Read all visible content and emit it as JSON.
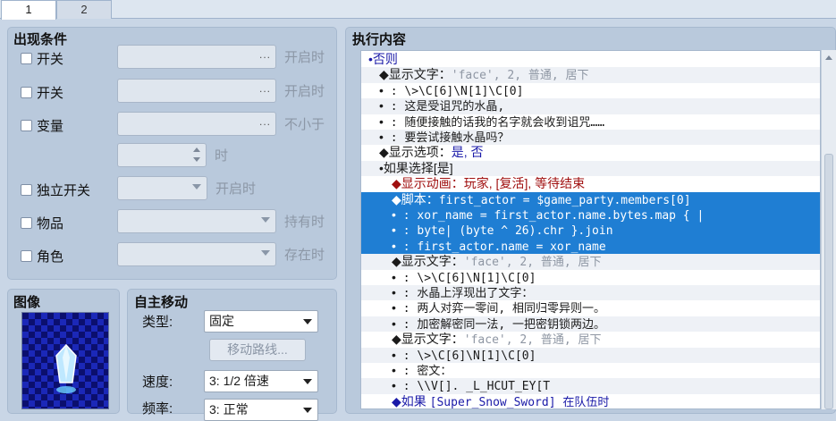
{
  "tabs": [
    {
      "label": "1",
      "active": true
    },
    {
      "label": "2",
      "active": false
    }
  ],
  "conditions": {
    "title": "出现条件",
    "rows": [
      {
        "label": "开关",
        "suffix": "开启时",
        "control": "dots"
      },
      {
        "label": "开关",
        "suffix": "开启时",
        "control": "dots"
      },
      {
        "label": "变量",
        "suffix": "不小于",
        "control": "dots"
      },
      {
        "label": "",
        "suffix": "时",
        "control": "spin"
      },
      {
        "label": "独立开关",
        "suffix": "开启时",
        "control": "dropdown"
      },
      {
        "label": "物品",
        "suffix": "持有时",
        "control": "dropdown"
      },
      {
        "label": "角色",
        "suffix": "存在时",
        "control": "dropdown"
      }
    ],
    "dots_glyph": "..."
  },
  "image": {
    "title": "图像"
  },
  "move": {
    "title": "自主移动",
    "type_label": "类型:",
    "type_value": "固定",
    "route_button": "移动路线...",
    "speed_label": "速度:",
    "speed_value": "3: 1/2 倍速",
    "freq_label": "频率:",
    "freq_value": "3: 正常"
  },
  "commands": {
    "title": "执行内容",
    "rows": [
      {
        "indent": 8,
        "segments": [
          {
            "t": "•否则",
            "c": "c-blue"
          }
        ]
      },
      {
        "indent": 20,
        "segments": [
          {
            "t": "◆显示文字：",
            "c": ""
          },
          {
            "t": "'face', 2, 普通, 居下",
            "c": "c-gray mono"
          }
        ]
      },
      {
        "indent": 20,
        "segments": [
          {
            "t": "•",
            "c": ""
          },
          {
            "t": "           : \\>\\C[6]\\N[1]\\C[0]",
            "c": "mono"
          }
        ]
      },
      {
        "indent": 20,
        "segments": [
          {
            "t": "•",
            "c": ""
          },
          {
            "t": "           : 这是受诅咒的水晶,",
            "c": "mono"
          }
        ]
      },
      {
        "indent": 20,
        "segments": [
          {
            "t": "•",
            "c": ""
          },
          {
            "t": "           : 随便接触的话我的名字就会收到诅咒……",
            "c": "mono"
          }
        ]
      },
      {
        "indent": 20,
        "segments": [
          {
            "t": "•",
            "c": ""
          },
          {
            "t": "           : 要尝试接触水晶吗？",
            "c": "mono"
          }
        ]
      },
      {
        "indent": 20,
        "segments": [
          {
            "t": "◆显示选项：",
            "c": ""
          },
          {
            "t": "是, 否",
            "c": "c-blue"
          }
        ]
      },
      {
        "indent": 20,
        "segments": [
          {
            "t": "•如果选择[是]",
            "c": ""
          }
        ]
      },
      {
        "indent": 34,
        "segments": [
          {
            "t": "◆显示动画：",
            "c": "c-red"
          },
          {
            "t": "玩家, [复活], 等待结束",
            "c": "c-red"
          }
        ]
      },
      {
        "indent": 34,
        "sel": true,
        "segments": [
          {
            "t": "◆脚本：",
            "c": ""
          },
          {
            "t": "first_actor = $game_party.members[0]",
            "c": "mono"
          }
        ]
      },
      {
        "indent": 34,
        "sel": true,
        "segments": [
          {
            "t": "•",
            "c": ""
          },
          {
            "t": "     : xor_name = first_actor.name.bytes.map { |",
            "c": "mono"
          }
        ]
      },
      {
        "indent": 34,
        "sel": true,
        "segments": [
          {
            "t": "•",
            "c": ""
          },
          {
            "t": "     : byte| (byte ^ 26).chr }.join",
            "c": "mono"
          }
        ]
      },
      {
        "indent": 34,
        "sel": true,
        "segments": [
          {
            "t": "•",
            "c": ""
          },
          {
            "t": "     : first_actor.name = xor_name",
            "c": "mono"
          }
        ]
      },
      {
        "indent": 34,
        "segments": [
          {
            "t": "◆显示文字：",
            "c": ""
          },
          {
            "t": "'face', 2, 普通, 居下",
            "c": "c-gray mono"
          }
        ]
      },
      {
        "indent": 34,
        "segments": [
          {
            "t": "•",
            "c": ""
          },
          {
            "t": "           : \\>\\C[6]\\N[1]\\C[0]",
            "c": "mono"
          }
        ]
      },
      {
        "indent": 34,
        "segments": [
          {
            "t": "•",
            "c": ""
          },
          {
            "t": "           : 水晶上浮现出了文字：",
            "c": "mono"
          }
        ]
      },
      {
        "indent": 34,
        "segments": [
          {
            "t": "•",
            "c": ""
          },
          {
            "t": "           : 两人对弈一零间, 相同归零异则一。",
            "c": "mono"
          }
        ]
      },
      {
        "indent": 34,
        "segments": [
          {
            "t": "•",
            "c": ""
          },
          {
            "t": "           : 加密解密同一法, 一把密钥锁两边。",
            "c": "mono"
          }
        ]
      },
      {
        "indent": 34,
        "segments": [
          {
            "t": "◆显示文字：",
            "c": ""
          },
          {
            "t": "'face', 2, 普通, 居下",
            "c": "c-gray mono"
          }
        ]
      },
      {
        "indent": 34,
        "segments": [
          {
            "t": "•",
            "c": ""
          },
          {
            "t": "           : \\>\\C[6]\\N[1]\\C[0]",
            "c": "mono"
          }
        ]
      },
      {
        "indent": 34,
        "segments": [
          {
            "t": "•",
            "c": ""
          },
          {
            "t": "           : 密文：",
            "c": "mono"
          }
        ]
      },
      {
        "indent": 34,
        "segments": [
          {
            "t": "•",
            "c": ""
          },
          {
            "t": "           : \\\\V[]. _L_HCUT_EY[T",
            "c": "mono"
          }
        ]
      },
      {
        "indent": 34,
        "segments": [
          {
            "t": "◆如果 ",
            "c": "c-blue"
          },
          {
            "t": "[Super_Snow_Sword] 在队伍时",
            "c": "c-blue mono"
          }
        ]
      }
    ]
  }
}
